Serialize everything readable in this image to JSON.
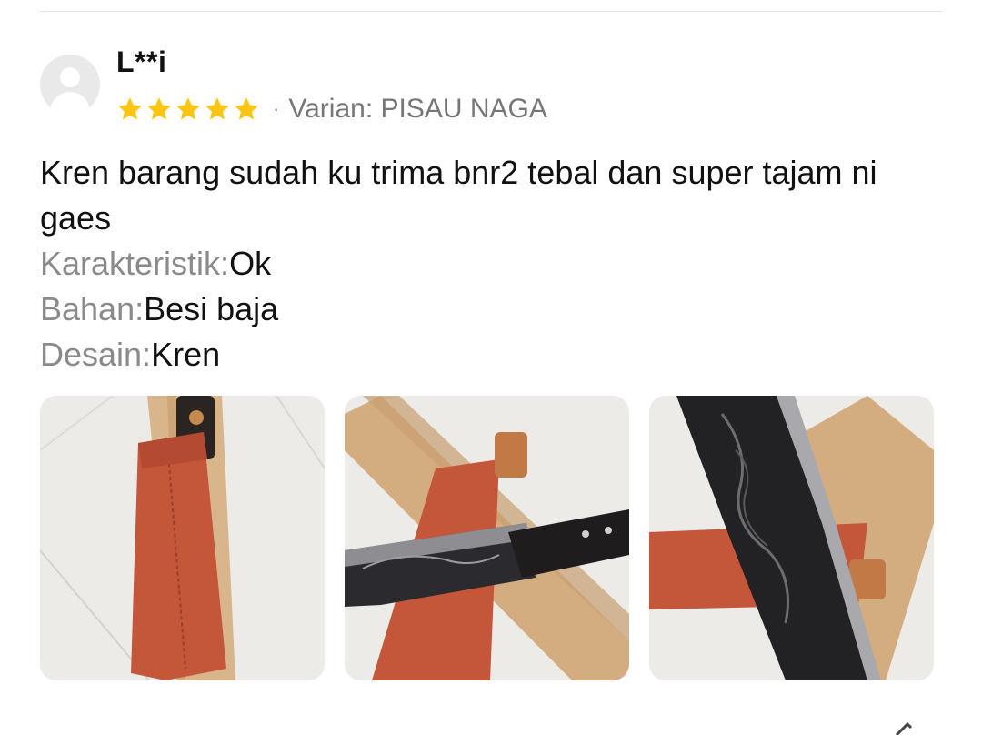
{
  "review": {
    "username": "L**i",
    "rating": 5,
    "rating_max": 5,
    "variant_text": "Varian: PISAU NAGA",
    "text": "Kren barang sudah ku trima bnr2 tebal dan super tajam ni gaes",
    "attributes": [
      {
        "label": "Karakteristik:",
        "value": "Ok"
      },
      {
        "label": "Bahan:",
        "value": "Besi baja"
      },
      {
        "label": "Desain:",
        "value": "Kren"
      }
    ],
    "photo_count": 3
  },
  "colors": {
    "star": "#FDC513",
    "label_gray": "#8a8a8a",
    "sheath": "#C4563A"
  },
  "icons": [
    "avatar-placeholder-icon",
    "star-icon",
    "edit-icon"
  ]
}
